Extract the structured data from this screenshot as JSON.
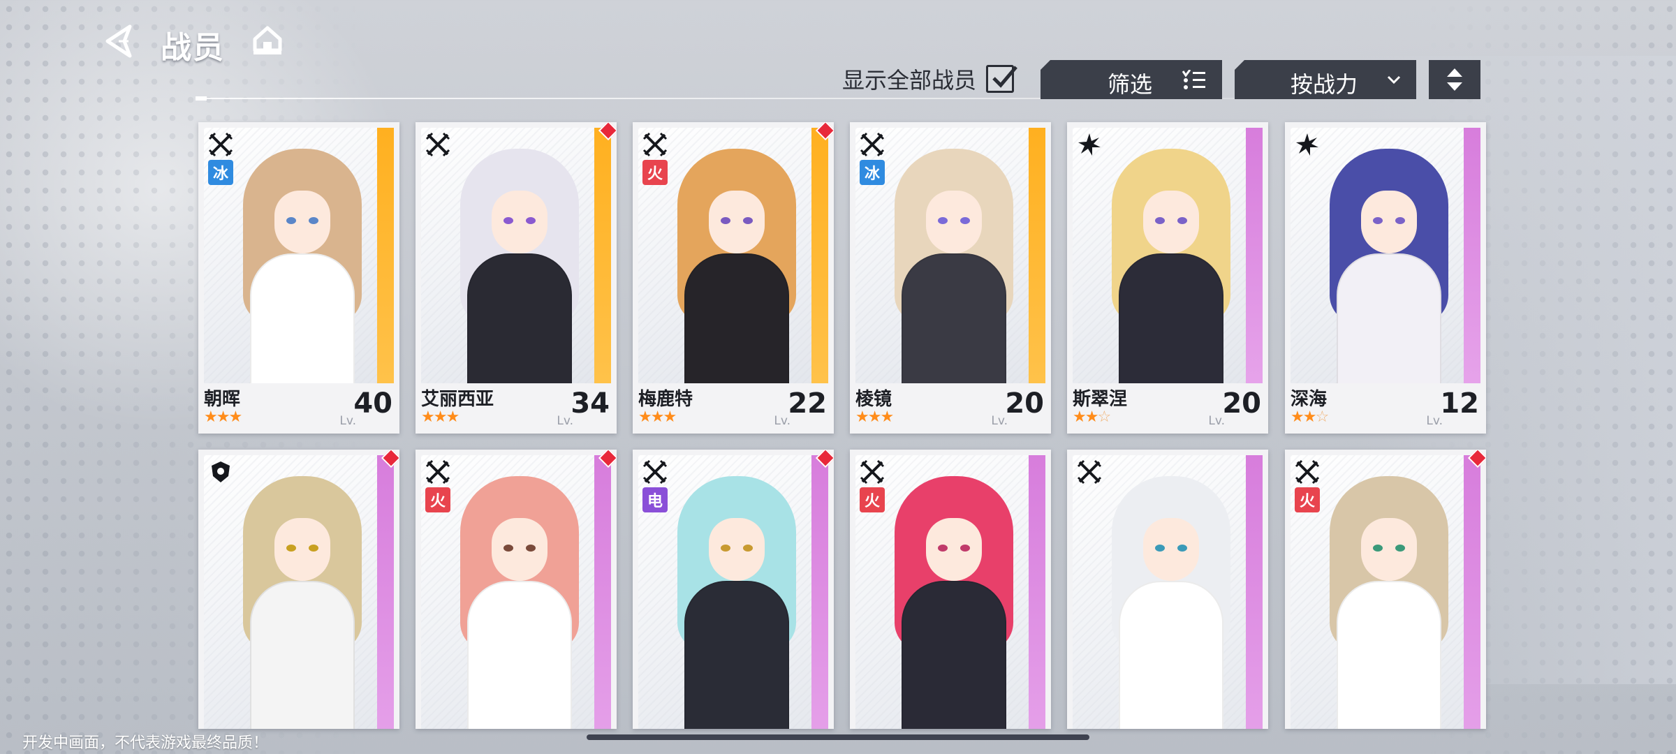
{
  "header": {
    "title": "战员",
    "back_icon": "back-arrow-icon",
    "home_icon": "home-icon"
  },
  "toolbar": {
    "show_all_label": "显示全部战员",
    "show_all_checked": true,
    "filter_label": "筛选",
    "sort_label": "按战力",
    "order_icon": "sort-order-icon"
  },
  "lv_prefix": "Lv.",
  "cards": [
    {
      "name": "朝晖",
      "stars": 3,
      "max_stars": 3,
      "level": "40",
      "class_icon": "crossed-swords-icon",
      "element": "冰",
      "element_type": "ice",
      "rarity": "gold",
      "is_new": false,
      "hair": "#d9b48e",
      "body": "#ffffff",
      "eye": "#5a86c8"
    },
    {
      "name": "艾丽西亚",
      "stars": 3,
      "max_stars": 3,
      "level": "34",
      "class_icon": "crossed-swords-icon",
      "element": "",
      "element_type": "",
      "rarity": "gold",
      "is_new": true,
      "hair": "#e6e4ee",
      "body": "#2a2a33",
      "eye": "#8a5ad0"
    },
    {
      "name": "梅鹿特",
      "stars": 3,
      "max_stars": 3,
      "level": "22",
      "class_icon": "crossed-swords-icon",
      "element": "火",
      "element_type": "fire",
      "rarity": "gold",
      "is_new": true,
      "hair": "#e4a55c",
      "body": "#262429",
      "eye": "#7a5ac0"
    },
    {
      "name": "棱镜",
      "stars": 3,
      "max_stars": 3,
      "level": "20",
      "class_icon": "crossed-swords-icon",
      "element": "冰",
      "element_type": "ice",
      "rarity": "gold",
      "is_new": false,
      "hair": "#e8d6bc",
      "body": "#3a3a44",
      "eye": "#7a6ad8"
    },
    {
      "name": "斯翠涅",
      "stars": 2,
      "max_stars": 3,
      "level": "20",
      "class_icon": "star-burst-icon",
      "element": "",
      "element_type": "",
      "rarity": "purple",
      "is_new": false,
      "hair": "#f0d48a",
      "body": "#2c2c38",
      "eye": "#7a62c8"
    },
    {
      "name": "深海",
      "stars": 2,
      "max_stars": 3,
      "level": "12",
      "class_icon": "star-burst-icon",
      "element": "",
      "element_type": "",
      "rarity": "purple",
      "is_new": false,
      "hair": "#4a4ea8",
      "body": "#f2f0f6",
      "eye": "#7a62c8"
    },
    {
      "name": "",
      "stars": 0,
      "max_stars": 0,
      "level": "",
      "class_icon": "shield-icon",
      "element": "",
      "element_type": "",
      "rarity": "purple",
      "is_new": true,
      "hair": "#d9c79c",
      "body": "#f4f4f4",
      "eye": "#c8a020"
    },
    {
      "name": "",
      "stars": 0,
      "max_stars": 0,
      "level": "",
      "class_icon": "crossed-swords-icon",
      "element": "火",
      "element_type": "fire",
      "rarity": "purple",
      "is_new": true,
      "hair": "#f0a196",
      "body": "#ffffff",
      "eye": "#7a4a3a"
    },
    {
      "name": "",
      "stars": 0,
      "max_stars": 0,
      "level": "",
      "class_icon": "crossed-swords-icon",
      "element": "电",
      "element_type": "elec",
      "rarity": "purple",
      "is_new": true,
      "hair": "#a8e2e6",
      "body": "#2a2c36",
      "eye": "#c89a30"
    },
    {
      "name": "",
      "stars": 0,
      "max_stars": 0,
      "level": "",
      "class_icon": "crossed-swords-icon",
      "element": "火",
      "element_type": "fire",
      "rarity": "purple",
      "is_new": false,
      "hair": "#e8406a",
      "body": "#2a2a36",
      "eye": "#c03a6a"
    },
    {
      "name": "",
      "stars": 0,
      "max_stars": 0,
      "level": "",
      "class_icon": "crossed-swords-icon",
      "element": "",
      "element_type": "",
      "rarity": "purple",
      "is_new": false,
      "hair": "#eceef2",
      "body": "#ffffff",
      "eye": "#3a9ab8"
    },
    {
      "name": "",
      "stars": 0,
      "max_stars": 0,
      "level": "",
      "class_icon": "crossed-swords-icon",
      "element": "火",
      "element_type": "fire",
      "rarity": "purple",
      "is_new": true,
      "hair": "#d8c6a8",
      "body": "#ffffff",
      "eye": "#3a9a7a"
    }
  ],
  "footer_note": "开发中画面，不代表游戏最终品质！"
}
